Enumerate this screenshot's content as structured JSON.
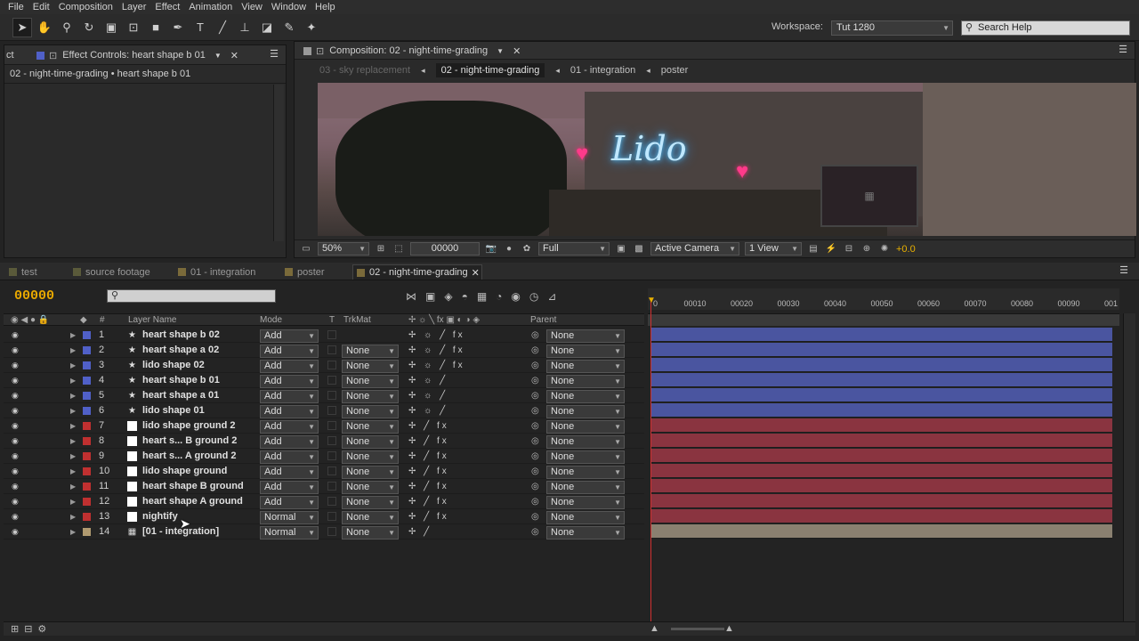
{
  "menu": [
    "File",
    "Edit",
    "Composition",
    "Layer",
    "Effect",
    "Animation",
    "View",
    "Window",
    "Help"
  ],
  "workspace": {
    "label": "Workspace:",
    "value": "Tut 1280"
  },
  "search_help": {
    "placeholder": "Search Help"
  },
  "effect_controls": {
    "left_tab": "ct",
    "tab": "Effect Controls: heart shape b 01",
    "subtitle": "02 - night-time-grading • heart shape b 01"
  },
  "composition": {
    "tab": "Composition: 02 - night-time-grading",
    "nav": [
      "03 - sky replacement",
      "02 - night-time-grading",
      "01 - integration",
      "poster"
    ],
    "nav_current": 1,
    "sign_text": "Lido",
    "footer": {
      "zoom": "50%",
      "timecode": "00000",
      "resolution": "Full",
      "camera": "Active Camera",
      "views": "1 View",
      "exposure": "+0.0"
    }
  },
  "timeline": {
    "tabs": [
      "test",
      "source footage",
      "01 - integration",
      "poster",
      "02 - night-time-grading"
    ],
    "tab_colors": [
      "#5a5a3a",
      "#5a5a3a",
      "#7a6a3a",
      "#7a6a3a",
      "#7a6a3a"
    ],
    "active_tab": 4,
    "timecode": "00000",
    "columns": {
      "num": "#",
      "layer_name": "Layer Name",
      "mode": "Mode",
      "t": "T",
      "trkmat": "TrkMat",
      "parent": "Parent"
    },
    "ruler": [
      "0",
      "00010",
      "00020",
      "00030",
      "00040",
      "00050",
      "00060",
      "00070",
      "00080",
      "00090",
      "001"
    ],
    "layers": [
      {
        "num": "1",
        "name": "heart shape b 02",
        "type": "shape",
        "label": "#5060c8",
        "mode": "Add",
        "trkmat": "",
        "switches": "✢ ☼ ╱ fx",
        "parent": "None",
        "bar": "#4a55a0"
      },
      {
        "num": "2",
        "name": "heart shape a 02",
        "type": "shape",
        "label": "#5060c8",
        "mode": "Add",
        "trkmat": "None",
        "switches": "✢ ☼ ╱ fx",
        "parent": "None",
        "bar": "#4a55a0"
      },
      {
        "num": "3",
        "name": "lido shape 02",
        "type": "shape",
        "label": "#5060c8",
        "mode": "Add",
        "trkmat": "None",
        "switches": "✢ ☼ ╱ fx",
        "parent": "None",
        "bar": "#4a55a0"
      },
      {
        "num": "4",
        "name": "heart shape b 01",
        "type": "shape",
        "label": "#5060c8",
        "mode": "Add",
        "trkmat": "None",
        "switches": "✢ ☼ ╱",
        "parent": "None",
        "bar": "#4a55a0"
      },
      {
        "num": "5",
        "name": "heart shape a 01",
        "type": "shape",
        "label": "#5060c8",
        "mode": "Add",
        "trkmat": "None",
        "switches": "✢ ☼ ╱",
        "parent": "None",
        "bar": "#4a55a0"
      },
      {
        "num": "6",
        "name": "lido shape 01",
        "type": "shape",
        "label": "#5060c8",
        "mode": "Add",
        "trkmat": "None",
        "switches": "✢ ☼ ╱",
        "parent": "None",
        "bar": "#4a55a0"
      },
      {
        "num": "7",
        "name": "lido shape ground 2",
        "type": "solid",
        "label": "#c03030",
        "mode": "Add",
        "trkmat": "None",
        "switches": "✢ ╱ fx",
        "parent": "None",
        "bar": "#8a3440"
      },
      {
        "num": "8",
        "name": "heart s... B ground 2",
        "type": "solid",
        "label": "#c03030",
        "mode": "Add",
        "trkmat": "None",
        "switches": "✢ ╱ fx",
        "parent": "None",
        "bar": "#8a3440"
      },
      {
        "num": "9",
        "name": "heart s... A ground 2",
        "type": "solid",
        "label": "#c03030",
        "mode": "Add",
        "trkmat": "None",
        "switches": "✢ ╱ fx",
        "parent": "None",
        "bar": "#8a3440"
      },
      {
        "num": "10",
        "name": "lido shape ground",
        "type": "solid",
        "label": "#c03030",
        "mode": "Add",
        "trkmat": "None",
        "switches": "✢ ╱ fx",
        "parent": "None",
        "bar": "#8a3440"
      },
      {
        "num": "11",
        "name": "heart shape B ground",
        "type": "solid",
        "label": "#c03030",
        "mode": "Add",
        "trkmat": "None",
        "switches": "✢ ╱ fx",
        "parent": "None",
        "bar": "#8a3440"
      },
      {
        "num": "12",
        "name": "heart shape A ground",
        "type": "solid",
        "label": "#c03030",
        "mode": "Add",
        "trkmat": "None",
        "switches": "✢ ╱ fx",
        "parent": "None",
        "bar": "#8a3440"
      },
      {
        "num": "13",
        "name": "nightify",
        "type": "solid",
        "label": "#c03030",
        "mode": "Normal",
        "trkmat": "None",
        "switches": "✢ ╱ fx",
        "parent": "None",
        "bar": "#8a3440"
      },
      {
        "num": "14",
        "name": "[01 - integration]",
        "type": "comp",
        "label": "#b09a70",
        "mode": "Normal",
        "trkmat": "None",
        "switches": "✢ ╱",
        "parent": "None",
        "bar": "#8a8070"
      }
    ]
  }
}
